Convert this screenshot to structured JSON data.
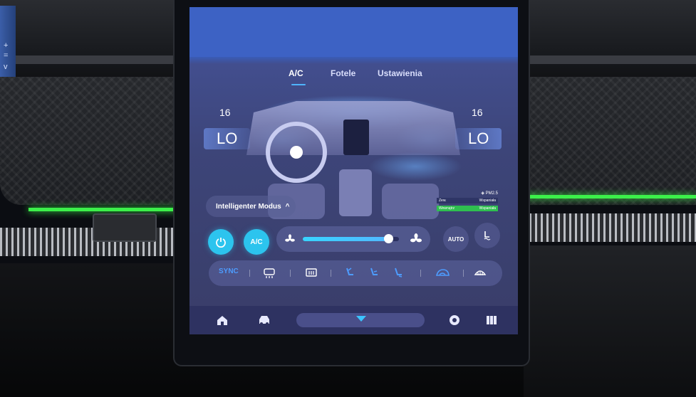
{
  "side_display": {
    "glyphs": [
      "+",
      "=",
      "v"
    ]
  },
  "tabs": [
    {
      "label": "A/C",
      "active": true
    },
    {
      "label": "Fotele",
      "active": false
    },
    {
      "label": "Ustawienia",
      "active": false
    }
  ],
  "climate": {
    "left": {
      "temp_value": "16",
      "temp_display": "LO"
    },
    "right": {
      "temp_value": "16",
      "temp_display": "LO"
    }
  },
  "mode": {
    "label": "Intelligenter Modus",
    "chevron": "^"
  },
  "pm25": {
    "header": "◈ PM2.5",
    "rows": [
      {
        "left": "Zew.",
        "right": "Wspaniała"
      },
      {
        "left": "Wewnątrz",
        "right": "Wspaniała"
      }
    ]
  },
  "controls": {
    "power_icon": "power-icon",
    "ac_label": "A/C",
    "fan_speed_fraction": 0.89,
    "auto_label": "AUTO"
  },
  "sync_bar": {
    "sync_label": "SYNC",
    "icons": [
      "rear-defrost-icon",
      "front-heat-icon",
      "seat-face-airflow-icon",
      "seat-body-airflow-icon",
      "seat-feet-airflow-icon",
      "recirculation-icon",
      "front-defrost-icon"
    ]
  },
  "bottom_nav": {
    "icons": [
      "home-icon",
      "car-icon",
      "handle-arrow-icon",
      "camera-icon",
      "apps-icon"
    ]
  },
  "colors": {
    "accent": "#2cc4ee",
    "sync_text": "#4d9cff",
    "pm_good": "#2fbf50",
    "ambient_green": "#3cf04a"
  }
}
